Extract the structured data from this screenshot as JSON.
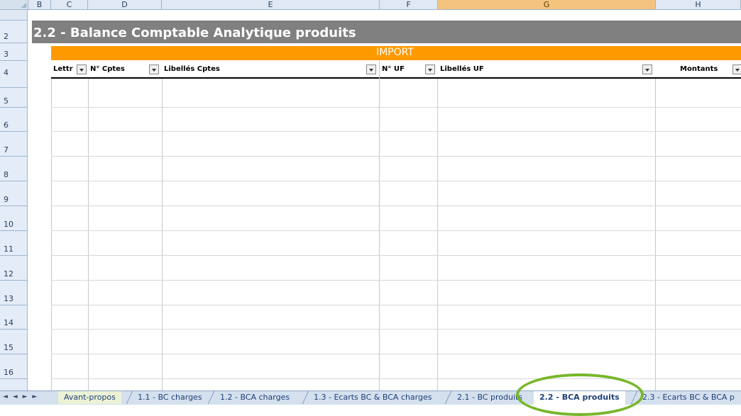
{
  "columns": [
    "B",
    "C",
    "D",
    "E",
    "F",
    "G",
    "H"
  ],
  "rows": [
    "2",
    "3",
    "4",
    "5",
    "6",
    "7",
    "8",
    "9",
    "10",
    "11",
    "12",
    "13",
    "14",
    "15",
    "16"
  ],
  "sheet": {
    "title": "2.2 - Balance Comptable Analytique produits",
    "band": "IMPORT",
    "headers": {
      "lettre": "Lettr",
      "num_cptes": "N° Cptes",
      "lib_cptes": "Libellés Cptes",
      "num_uf": "N° UF",
      "lib_uf": "Libellés UF",
      "montants": "Montants"
    }
  },
  "tabs": [
    "Avant-propos",
    "1.1 - BC charges",
    "1.2 - BCA charges",
    "1.3 - Ecarts BC & BCA charges",
    "2.1 - BC produits",
    "2.2 - BCA produits",
    "2.3 - Ecarts BC & BCA p"
  ],
  "nav": "◄ ◄ ► ►",
  "colors": {
    "title_band": "#808080",
    "import_band": "#ff9900",
    "highlight_ring": "#77b72a"
  }
}
